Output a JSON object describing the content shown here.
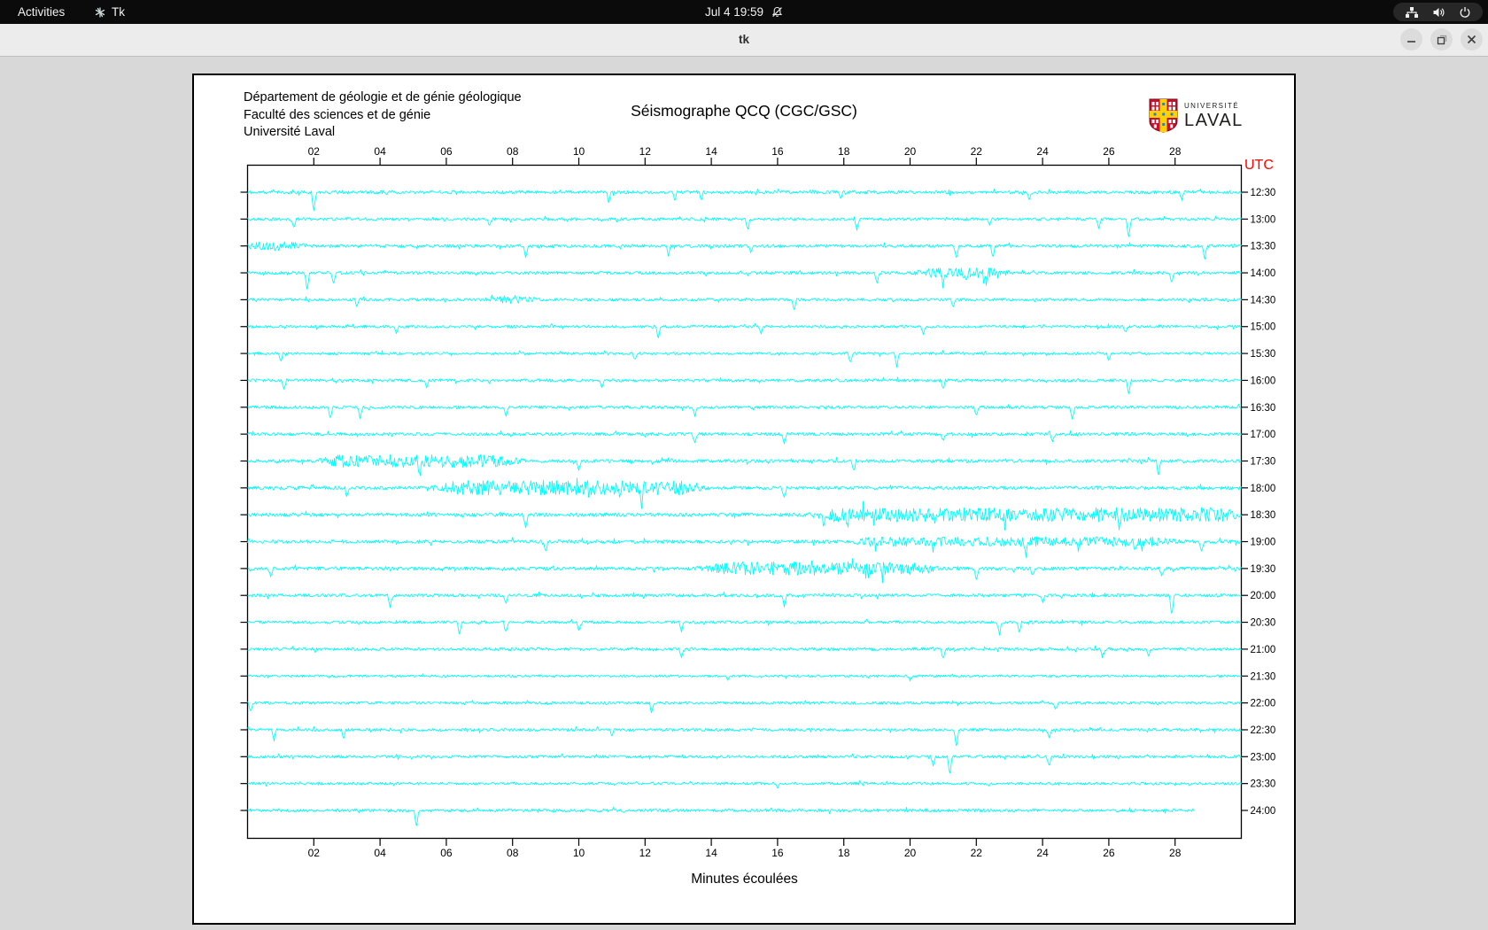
{
  "topbar": {
    "activities_label": "Activities",
    "app_name": "Tk",
    "clock": "Jul 4 19:59",
    "icons": [
      "tk-app-icon",
      "bell-muted-icon",
      "network-wired-icon",
      "volume-icon",
      "power-icon"
    ],
    "bg_color": "#0b0b0b"
  },
  "window": {
    "title": "tk",
    "controls": [
      "minimize",
      "maximize",
      "close"
    ]
  },
  "panel": {
    "header_lines": "Département de géologie et de génie géologique\nFaculté des sciences et de génie\nUniversité Laval",
    "logo": {
      "line1": "UNIVERSITÉ",
      "line2": "LAVAL"
    }
  },
  "chart_data": {
    "type": "line",
    "title": "Séismographe QCQ (CGC/GSC)",
    "xlabel": "Minutes écoulées",
    "right_axis_title": "UTC",
    "x_range": [
      0,
      30
    ],
    "x_ticks": [
      "02",
      "04",
      "06",
      "08",
      "10",
      "12",
      "14",
      "16",
      "18",
      "20",
      "22",
      "24",
      "26",
      "28"
    ],
    "trace_color": "#00ffff",
    "utc_color": "#ff0000",
    "axis_color": "#000000",
    "grid": false,
    "rows": [
      {
        "label": "12:30",
        "noise": 1.7,
        "end": 30,
        "spikes": [
          [
            2.0,
            24
          ],
          [
            10.9,
            12
          ],
          [
            12.9,
            10
          ],
          [
            13.7,
            10
          ],
          [
            17.9,
            8
          ],
          [
            23.6,
            8
          ],
          [
            28.2,
            9
          ]
        ],
        "bursts": []
      },
      {
        "label": "13:00",
        "noise": 1.6,
        "end": 30,
        "spikes": [
          [
            1.4,
            12
          ],
          [
            7.3,
            8
          ],
          [
            15.1,
            14
          ],
          [
            18.4,
            12
          ],
          [
            22.4,
            8
          ],
          [
            25.7,
            10
          ],
          [
            26.6,
            22
          ]
        ],
        "bursts": []
      },
      {
        "label": "13:30",
        "noise": 1.7,
        "end": 30,
        "spikes": [
          [
            8.4,
            12
          ],
          [
            12.7,
            10
          ],
          [
            15.2,
            8
          ],
          [
            21.4,
            15
          ],
          [
            22.5,
            15
          ],
          [
            28.9,
            16
          ]
        ],
        "bursts": [
          [
            0.0,
            1.6,
            3.0
          ]
        ]
      },
      {
        "label": "14:00",
        "noise": 1.6,
        "end": 30,
        "spikes": [
          [
            1.8,
            20
          ],
          [
            2.6,
            14
          ],
          [
            19.0,
            12
          ],
          [
            21.0,
            16
          ],
          [
            21.7,
            14
          ],
          [
            22.3,
            14
          ],
          [
            27.9,
            10
          ]
        ],
        "bursts": [
          [
            20.3,
            22.8,
            3.5
          ]
        ]
      },
      {
        "label": "14:30",
        "noise": 1.5,
        "end": 30,
        "spikes": [
          [
            3.3,
            8
          ],
          [
            16.5,
            12
          ],
          [
            21.3,
            8
          ]
        ],
        "bursts": [
          [
            7.5,
            8.5,
            3.5
          ]
        ]
      },
      {
        "label": "15:00",
        "noise": 1.5,
        "end": 30,
        "spikes": [
          [
            4.5,
            8
          ],
          [
            12.4,
            14
          ],
          [
            15.5,
            9
          ],
          [
            20.4,
            9
          ],
          [
            26.5,
            8
          ]
        ],
        "bursts": []
      },
      {
        "label": "15:30",
        "noise": 1.5,
        "end": 30,
        "spikes": [
          [
            1.0,
            10
          ],
          [
            11.7,
            8
          ],
          [
            18.2,
            10
          ],
          [
            19.6,
            16
          ],
          [
            26.0,
            8
          ]
        ],
        "bursts": []
      },
      {
        "label": "16:00",
        "noise": 1.6,
        "end": 30,
        "spikes": [
          [
            1.1,
            12
          ],
          [
            5.4,
            8
          ],
          [
            10.7,
            10
          ],
          [
            21.0,
            10
          ],
          [
            26.6,
            16
          ]
        ],
        "bursts": []
      },
      {
        "label": "16:30",
        "noise": 1.6,
        "end": 30,
        "spikes": [
          [
            2.5,
            14
          ],
          [
            3.4,
            12
          ],
          [
            7.8,
            12
          ],
          [
            13.5,
            10
          ],
          [
            22.0,
            10
          ],
          [
            24.9,
            14
          ]
        ],
        "bursts": []
      },
      {
        "label": "17:00",
        "noise": 1.7,
        "end": 30,
        "spikes": [
          [
            13.5,
            10
          ],
          [
            16.2,
            10
          ],
          [
            21.0,
            8
          ],
          [
            24.3,
            8
          ]
        ],
        "bursts": []
      },
      {
        "label": "17:30",
        "noise": 1.8,
        "end": 30,
        "spikes": [
          [
            5.2,
            14
          ],
          [
            10.0,
            12
          ],
          [
            18.3,
            12
          ],
          [
            27.5,
            16
          ]
        ],
        "bursts": [
          [
            2.4,
            8.0,
            4.0
          ]
        ]
      },
      {
        "label": "18:00",
        "noise": 1.8,
        "end": 30,
        "spikes": [
          [
            3.0,
            12
          ],
          [
            11.9,
            16
          ],
          [
            16.2,
            12
          ]
        ],
        "bursts": [
          [
            5.8,
            13.6,
            4.5
          ]
        ]
      },
      {
        "label": "18:30",
        "noise": 2.0,
        "end": 30,
        "spikes": [
          [
            8.4,
            14
          ],
          [
            17.4,
            12
          ],
          [
            18.1,
            12
          ],
          [
            26.3,
            12
          ]
        ],
        "bursts": [
          [
            17.3,
            29.8,
            4.0
          ]
        ]
      },
      {
        "label": "19:00",
        "noise": 1.9,
        "end": 30,
        "spikes": [
          [
            9.0,
            12
          ],
          [
            23.5,
            14
          ],
          [
            26.8,
            14
          ],
          [
            28.8,
            12
          ]
        ],
        "bursts": [
          [
            18.5,
            27.8,
            2.8
          ]
        ]
      },
      {
        "label": "19:30",
        "noise": 1.9,
        "end": 30,
        "spikes": [
          [
            0.7,
            10
          ],
          [
            22.0,
            14
          ],
          [
            23.7,
            10
          ],
          [
            27.6,
            10
          ]
        ],
        "bursts": [
          [
            13.9,
            20.6,
            4.0
          ]
        ]
      },
      {
        "label": "20:00",
        "noise": 1.7,
        "end": 30,
        "spikes": [
          [
            4.3,
            14
          ],
          [
            7.8,
            10
          ],
          [
            16.2,
            12
          ],
          [
            24.0,
            8
          ],
          [
            27.9,
            24
          ]
        ],
        "bursts": []
      },
      {
        "label": "20:30",
        "noise": 1.6,
        "end": 30,
        "spikes": [
          [
            6.4,
            14
          ],
          [
            7.8,
            12
          ],
          [
            10.0,
            10
          ],
          [
            13.1,
            10
          ],
          [
            22.7,
            14
          ],
          [
            23.3,
            12
          ]
        ],
        "bursts": []
      },
      {
        "label": "21:00",
        "noise": 1.6,
        "end": 30,
        "spikes": [
          [
            13.1,
            10
          ],
          [
            21.0,
            12
          ],
          [
            25.8,
            10
          ],
          [
            27.2,
            8
          ]
        ],
        "bursts": []
      },
      {
        "label": "21:30",
        "noise": 1.3,
        "end": 30,
        "spikes": [
          [
            14.5,
            5
          ],
          [
            20.0,
            5
          ]
        ],
        "bursts": []
      },
      {
        "label": "22:00",
        "noise": 1.5,
        "end": 30,
        "spikes": [
          [
            0.1,
            10
          ],
          [
            12.2,
            12
          ],
          [
            24.4,
            8
          ]
        ],
        "bursts": []
      },
      {
        "label": "22:30",
        "noise": 1.6,
        "end": 30,
        "spikes": [
          [
            0.8,
            10
          ],
          [
            2.9,
            10
          ],
          [
            11.0,
            8
          ],
          [
            21.4,
            22
          ],
          [
            24.2,
            10
          ]
        ],
        "bursts": []
      },
      {
        "label": "23:00",
        "noise": 1.5,
        "end": 30,
        "spikes": [
          [
            20.7,
            10
          ],
          [
            21.2,
            20
          ],
          [
            24.2,
            10
          ]
        ],
        "bursts": []
      },
      {
        "label": "23:30",
        "noise": 1.4,
        "end": 30,
        "spikes": [
          [
            16.0,
            5
          ]
        ],
        "bursts": []
      },
      {
        "label": "24:00",
        "noise": 1.6,
        "end": 28.6,
        "spikes": [
          [
            5.1,
            20
          ]
        ],
        "bursts": []
      }
    ]
  }
}
